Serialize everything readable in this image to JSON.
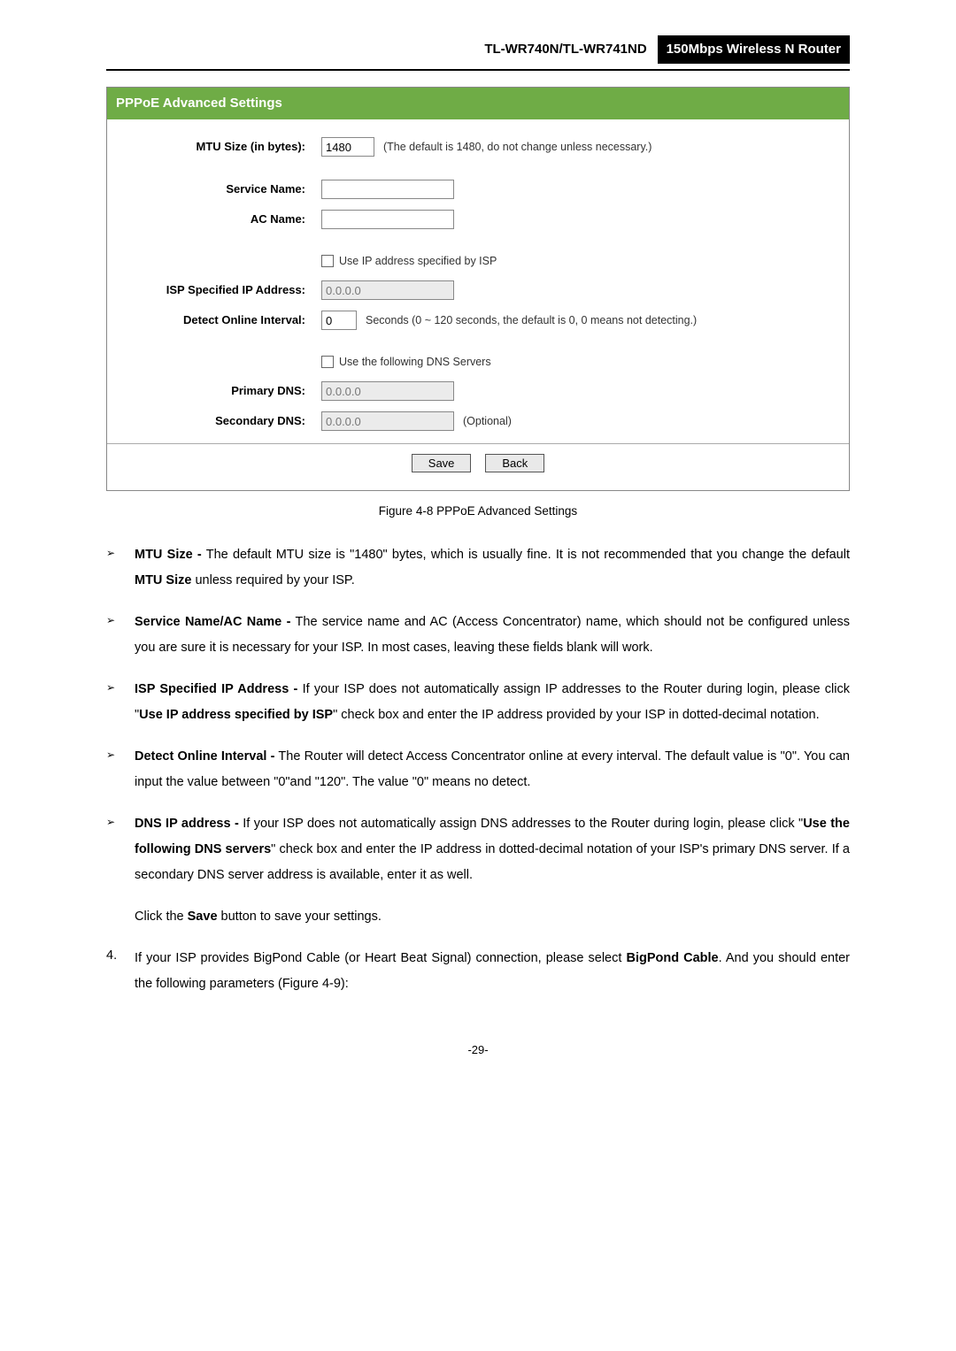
{
  "header": {
    "model": "TL-WR740N/TL-WR741ND",
    "desc": "150Mbps Wireless N Router"
  },
  "panel": {
    "title": "PPPoE Advanced Settings",
    "mtu": {
      "label": "MTU Size (in bytes):",
      "value": "1480",
      "hint": "(The default is 1480, do not change unless necessary.)"
    },
    "serviceName": {
      "label": "Service Name:"
    },
    "acName": {
      "label": "AC Name:"
    },
    "ispCheckbox": "Use IP address specified by ISP",
    "ispIp": {
      "label": "ISP Specified IP Address:",
      "value": "0.0.0.0"
    },
    "detect": {
      "label": "Detect Online Interval:",
      "value": "0",
      "hint": "Seconds (0 ~ 120 seconds, the default is 0, 0 means not detecting.)"
    },
    "dnsCheckbox": "Use the following DNS Servers",
    "primaryDns": {
      "label": "Primary DNS:",
      "value": "0.0.0.0"
    },
    "secondaryDns": {
      "label": "Secondary DNS:",
      "value": "0.0.0.0",
      "optional": "(Optional)"
    },
    "save": "Save",
    "back": "Back"
  },
  "caption": "Figure 4-8    PPPoE Advanced Settings",
  "bullets": {
    "mtu": {
      "prefix": "MTU Size -",
      "text1": " The default MTU size is \"1480\" bytes, which is usually fine. It is not recommended that you change the default ",
      "bold1": "MTU Size",
      "text2": " unless required by your ISP."
    },
    "svc": {
      "prefix": "Service Name/AC Name -",
      "text": " The service name and AC (Access Concentrator) name, which should not be configured unless you are sure it is necessary for your ISP. In most cases, leaving these fields blank will work."
    },
    "isp": {
      "prefix": "ISP Specified IP Address -",
      "text1": " If your ISP does not automatically assign IP addresses to the Router during login, please click \"",
      "bold1": "Use IP address specified by ISP",
      "text2": "\" check box and enter the IP address provided by your ISP in dotted-decimal notation."
    },
    "detect": {
      "prefix": "Detect Online Interval -",
      "text": " The Router will detect Access Concentrator online at every interval. The default value is \"0\". You can input the value between \"0\"and \"120\". The value \"0\" means no detect."
    },
    "dns": {
      "prefix": "DNS IP address -",
      "text1": " If your ISP does not automatically assign DNS addresses to the Router during login, please click \"",
      "bold1": "Use the following DNS servers",
      "text2": "\" check box and enter the IP address in dotted-decimal notation of your ISP's primary DNS server. If a secondary DNS server address is available, enter it as well."
    }
  },
  "savePara": {
    "text1": "Click the ",
    "bold": "Save",
    "text2": " button to save your settings."
  },
  "numItem": {
    "num": "4.",
    "text1": "If your ISP provides BigPond Cable (or Heart Beat Signal) connection, please select ",
    "bold": "BigPond Cable",
    "text2": ". And you should enter the following parameters (Figure 4-9):"
  },
  "pageNum": "-29-"
}
